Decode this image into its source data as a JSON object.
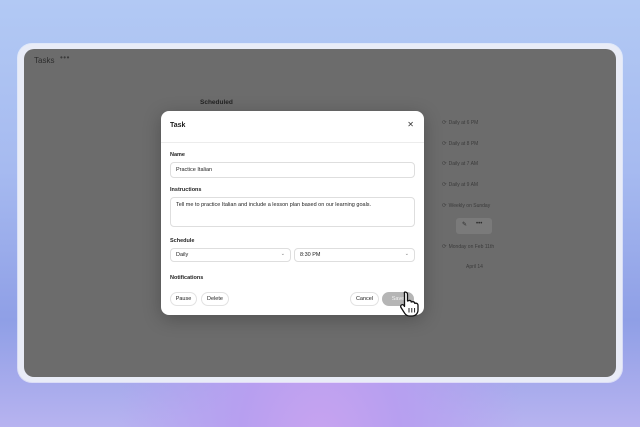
{
  "app": {
    "title": "Tasks",
    "more_label": "•••",
    "section_title": "Scheduled",
    "schedule_list": [
      "Daily at 6 PM",
      "Daily at 8 PM",
      "Daily at 7 AM",
      "Daily at 9 AM",
      "Weekly on Sunday",
      "Monday on Feb 11th",
      "April 14"
    ],
    "row_actions": {
      "edit_icon": "pencil-icon",
      "more_icon": "more-icon"
    }
  },
  "modal": {
    "title": "Task",
    "close_icon": "close-icon",
    "name_label": "Name",
    "name_value": "Practice Italian",
    "instructions_label": "Instructions",
    "instructions_value": "Tell me to practice Italian and include a lesson plan based on our learning goals.",
    "schedule_label": "Schedule",
    "frequency_value": "Daily",
    "time_value": "8:30 PM",
    "notifications_label": "Notifications",
    "pause_label": "Pause",
    "delete_label": "Delete",
    "cancel_label": "Cancel",
    "save_label": "Save"
  },
  "colors": {
    "overlay": "#6c6c6c",
    "primary_button": "#b5b5b5"
  }
}
